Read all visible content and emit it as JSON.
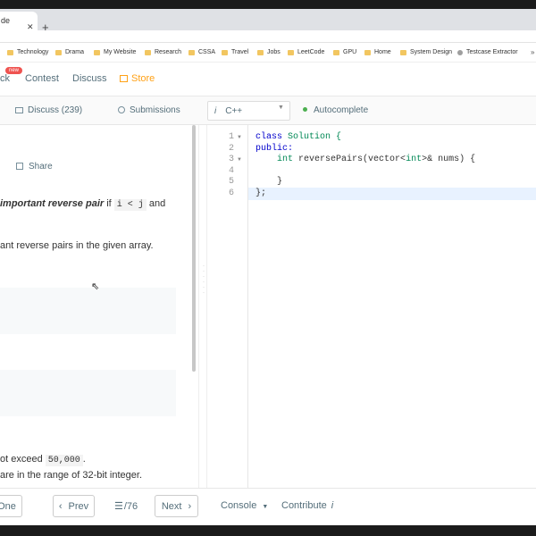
{
  "browser": {
    "tab_title": "de",
    "tab_close": "✕",
    "new_tab": "+",
    "bookmarks": [
      "Technology",
      "Drama",
      "My Website",
      "Research",
      "CSSA",
      "Travel",
      "Jobs",
      "LeetCode",
      "GPU",
      "Home",
      "System Design",
      "Testcase Extractor"
    ],
    "bookmarks_more": "»"
  },
  "navbar": {
    "items": [
      "ck",
      "Contest",
      "Discuss",
      "Store"
    ],
    "badge": "new"
  },
  "subbar": {
    "discuss": "Discuss (239)",
    "submissions": "Submissions",
    "language_prefix": "i",
    "language": "C++",
    "autocomplete": "Autocomplete"
  },
  "description": {
    "share": "Share",
    "line1": {
      "bold": "important reverse pair",
      "if": " if ",
      "code": "i < j",
      "and": " and"
    },
    "line2": "ant reverse pairs in the given array.",
    "note1": {
      "prefix": "ot exceed ",
      "code": "50,000",
      "suffix": "."
    },
    "note2": "are in the range of 32-bit integer."
  },
  "editor": {
    "line_numbers": [
      "1",
      "2",
      "3",
      "4",
      "5",
      "6"
    ],
    "lines": {
      "l1_kw": "class",
      "l1_name": " Solution {",
      "l2": "public:",
      "l3_indent": "    ",
      "l3_type": "int",
      "l3_rest": " reversePairs(vector<",
      "l3_type2": "int",
      "l3_end": ">& nums) {",
      "l4": "",
      "l5": "    }",
      "l6": "};"
    }
  },
  "footer": {
    "pick_one": "One",
    "prev": "Prev",
    "page": "/76",
    "next": "Next",
    "console": "Console",
    "contribute": "Contribute"
  }
}
